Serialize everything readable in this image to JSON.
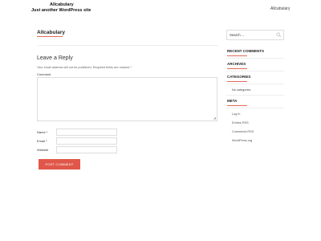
{
  "header": {
    "site_name": "Allcabulary",
    "site_description": "Just another WordPress site",
    "nav_link": "Allcabulary"
  },
  "main": {
    "page_title": "Allcabulary",
    "reply": {
      "title": "Leave a Reply",
      "note": "Your email address will not be published. Required fields are marked *",
      "comment_label": "Comment",
      "name_label": "Name *",
      "email_label": "Email *",
      "website_label": "Website",
      "submit_label": "Post Comment"
    }
  },
  "sidebar": {
    "search_placeholder": "Search ...",
    "recent_comments_title": "Recent Comments",
    "archives_title": "Archives",
    "categories_title": "Categories",
    "no_categories": "No categories",
    "meta_title": "Meta",
    "meta_links": [
      "Log in",
      "Entries RSS",
      "Comments RSS",
      "WordPress.org"
    ]
  },
  "colors": {
    "accent": "#e56a5a",
    "button": "#e0574a"
  }
}
